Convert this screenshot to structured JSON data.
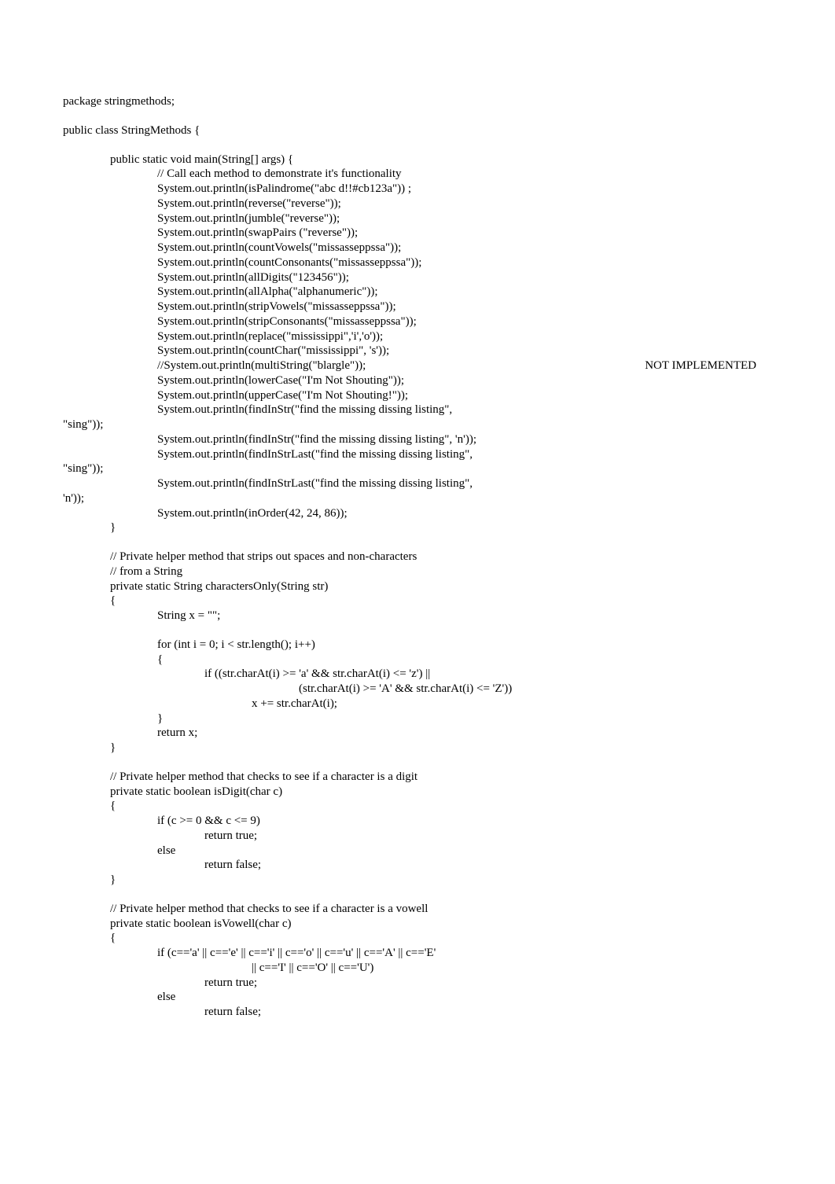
{
  "code": {
    "package": "package stringmethods;",
    "class_decl": "public class StringMethods {",
    "main_decl": "public static void main(String[] args) {",
    "main_comment": "// Call each method to demonstrate it's functionality",
    "main_lines": [
      "System.out.println(isPalindrome(\"abc d!!#cb123a\")) ;",
      "System.out.println(reverse(\"reverse\"));",
      "System.out.println(jumble(\"reverse\"));",
      "System.out.println(swapPairs (\"reverse\"));",
      "System.out.println(countVowels(\"missasseppssa\"));",
      "System.out.println(countConsonants(\"missasseppssa\"));",
      "System.out.println(allDigits(\"123456\"));",
      "System.out.println(allAlpha(\"alphanumeric\"));",
      "System.out.println(stripVowels(\"missasseppssa\"));",
      "System.out.println(stripConsonants(\"missasseppssa\"));",
      "System.out.println(replace(\"mississippi\",'i','o'));",
      "System.out.println(countChar(\"mississippi\", 's'));"
    ],
    "not_impl_left": "//System.out.println(multiString(\"blargle\"));",
    "not_impl_right": "NOT IMPLEMENTED",
    "main_lines2": [
      "System.out.println(lowerCase(\"I'm Not Shouting\"));",
      "System.out.println(upperCase(\"I'm Not Shouting!\"));",
      "System.out.println(findInStr(\"find the missing dissing listing\","
    ],
    "wrap1": "\"sing\"));",
    "main_lines3": [
      "System.out.println(findInStr(\"find the missing dissing listing\", 'n'));",
      "System.out.println(findInStrLast(\"find the missing dissing listing\","
    ],
    "wrap2": "\"sing\"));",
    "main_lines4": [
      "System.out.println(findInStrLast(\"find the missing dissing listing\","
    ],
    "wrap3": "'n'));",
    "main_lines5": [
      "System.out.println(inOrder(42, 24, 86));"
    ],
    "main_close": "}",
    "helper1_comment1": "// Private helper method that strips out spaces and non-characters",
    "helper1_comment2": "// from a String",
    "helper1_decl": "private static String charactersOnly(String str)",
    "open_brace": "{",
    "helper1_body1": "String x = \"\";",
    "helper1_for": "for (int i = 0; i < str.length(); i++)",
    "helper1_if": "if ((str.charAt(i) >= 'a' && str.charAt(i) <= 'z') ||",
    "helper1_if2": "(str.charAt(i) >= 'A' && str.charAt(i) <= 'Z'))",
    "helper1_assign": "x += str.charAt(i);",
    "close_brace": "}",
    "helper1_return": "return x;",
    "helper2_comment": "// Private helper method that checks to see if a character is a digit",
    "helper2_decl": "private static boolean isDigit(char c)",
    "helper2_if": "if (c >= 0 && c <= 9)",
    "return_true": "return true;",
    "else": "else",
    "return_false": "return false;",
    "helper3_comment": "// Private helper method that checks to see if a character is a vowell",
    "helper3_decl": "private static boolean isVowell(char c)",
    "helper3_if": "if (c=='a' || c=='e' || c=='i' || c=='o' || c=='u' || c=='A' || c=='E'",
    "helper3_if2": "|| c=='I' || c=='O' || c=='U')"
  }
}
